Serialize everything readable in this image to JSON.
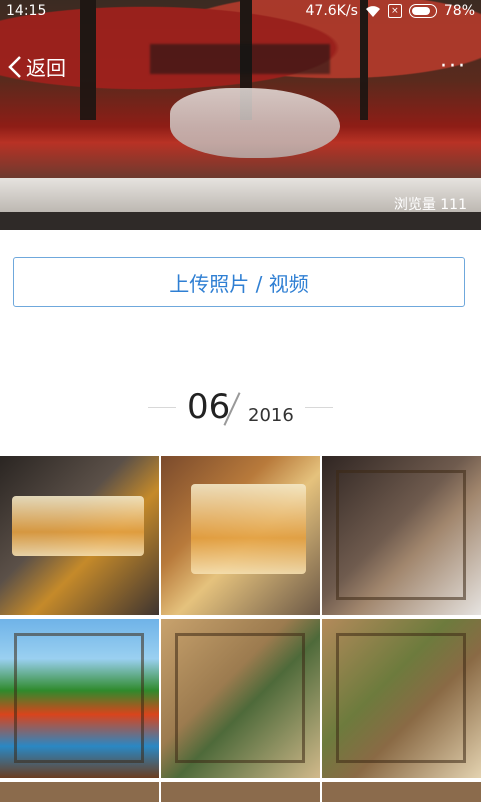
{
  "status_bar": {
    "time": "14:15",
    "speed": "47.6K/s",
    "battery": "78%"
  },
  "header": {
    "back_label": "返回",
    "more_label": "···",
    "views_text": "浏览量 111"
  },
  "upload_button": {
    "label": "上传照片 / 视频"
  },
  "date_group": {
    "month": "06",
    "year": "2016"
  },
  "photos": [
    {
      "icon": "amber-glass-horses"
    },
    {
      "icon": "amber-glass-calligraphy"
    },
    {
      "icon": "wood-carving-wolf"
    },
    {
      "icon": "river-autumn-painting"
    },
    {
      "icon": "wood-carving-deer-forest"
    },
    {
      "icon": "wood-carving-deer-birch"
    }
  ]
}
